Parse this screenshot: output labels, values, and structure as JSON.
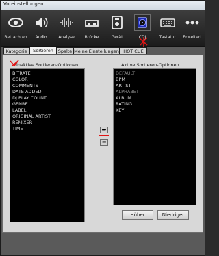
{
  "window": {
    "title": "Voreinstellungen"
  },
  "toolbar": {
    "items": [
      {
        "label": "Betrachten",
        "icon": "eye-icon"
      },
      {
        "label": "Audio",
        "icon": "speaker-icon"
      },
      {
        "label": "Analyse",
        "icon": "waveform-icon"
      },
      {
        "label": "Brücke",
        "icon": "bridge-icon"
      },
      {
        "label": "Gerät",
        "icon": "device-icon"
      },
      {
        "label": "CDJ",
        "icon": "cdj-icon"
      },
      {
        "label": "Tastatur",
        "icon": "keyboard-icon"
      },
      {
        "label": "Erweitert",
        "icon": "more-dots-icon"
      }
    ],
    "selected": "CDJ"
  },
  "tabs": [
    "Kategorie",
    "Sortieren",
    "Spalte",
    "Meine Einstellungen",
    "HOT CUE"
  ],
  "active_tab": "Sortieren",
  "inactive": {
    "title": "Inaktive Sortieren-Optionen",
    "items": [
      "BITRATE",
      "COLOR",
      "COMMENTS",
      "DATE ADDED",
      "DJ PLAY COUNT",
      "GENRE",
      "LABEL",
      "ORIGINAL ARTIST",
      "REMIXER",
      "TIME"
    ]
  },
  "active": {
    "title": "Aktive Sortieren-Optionen",
    "items": [
      {
        "label": "DEFAULT",
        "dim": true
      },
      {
        "label": "BPM",
        "dim": false
      },
      {
        "label": "ARTIST",
        "dim": false
      },
      {
        "label": "ALPHABET",
        "dim": true
      },
      {
        "label": "ALBUM",
        "dim": false
      },
      {
        "label": "RATING",
        "dim": false
      },
      {
        "label": "KEY",
        "dim": false
      }
    ]
  },
  "buttons": {
    "move_right": "➡",
    "move_left": "⬅",
    "higher": "Höher",
    "lower": "Niedriger"
  },
  "colors": {
    "annotation_red": "#e01515",
    "toolbar_dark": "#1c1c1c",
    "list_bg": "#000000"
  }
}
